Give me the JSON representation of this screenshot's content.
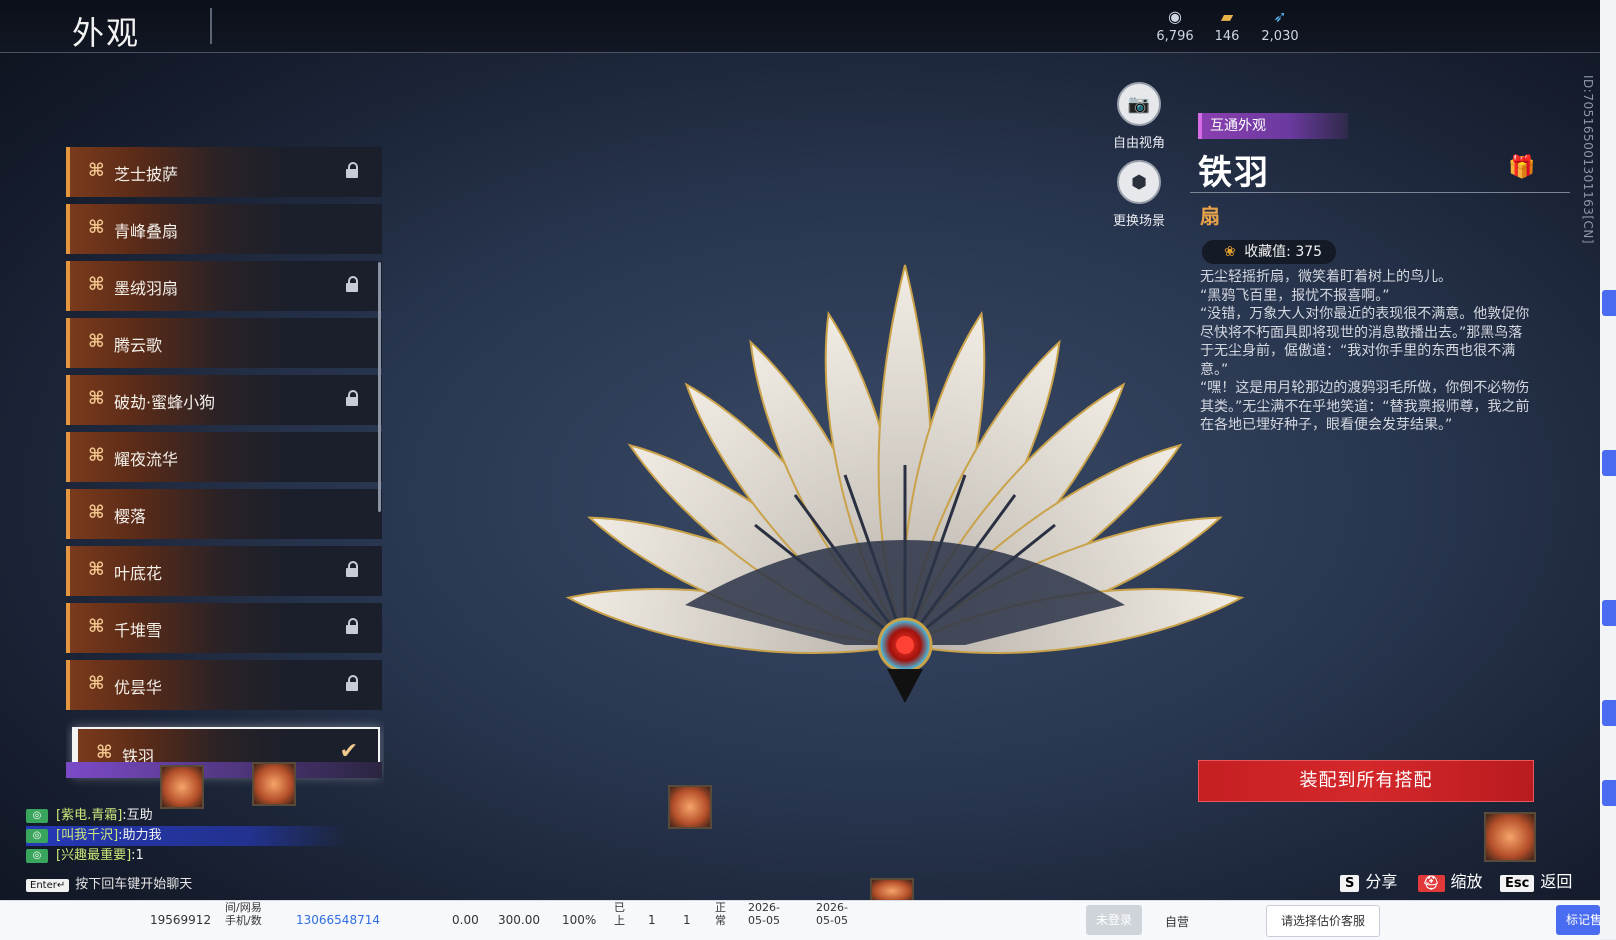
{
  "header": {
    "title": "外观",
    "currencies": [
      {
        "icon": "coin-icon",
        "value": "6,796"
      },
      {
        "icon": "ticket-icon",
        "value": "146"
      },
      {
        "icon": "feather-icon",
        "value": "2,030"
      }
    ]
  },
  "id_text": "ID:705165001301163[CN]",
  "list": {
    "items": [
      {
        "name": "芝士披萨",
        "locked": true
      },
      {
        "name": "青峰叠扇",
        "locked": false
      },
      {
        "name": "墨绒羽扇",
        "locked": true
      },
      {
        "name": "腾云歌",
        "locked": false
      },
      {
        "name": "破劫·蜜蜂小狗",
        "locked": true
      },
      {
        "name": "耀夜流华",
        "locked": false
      },
      {
        "name": "樱落",
        "locked": false
      },
      {
        "name": "叶底花",
        "locked": true
      },
      {
        "name": "千堆雪",
        "locked": true
      },
      {
        "name": "优昙华",
        "locked": true
      },
      {
        "name": "铁羽",
        "locked": false,
        "selected": true
      }
    ]
  },
  "camera": {
    "free_view": "自由视角",
    "change_scene": "更换场景"
  },
  "info": {
    "tag": "互通外观",
    "name": "铁羽",
    "category": "扇",
    "collect_label": "收藏值: 375",
    "description": [
      "无尘轻摇折扇，微笑着盯着树上的鸟儿。",
      "“黑鸦飞百里，报忧不报喜啊。”",
      "“没错，万象大人对你最近的表现很不满意。他敦促你尽快将不朽面具即将现世的消息散播出去。”那黑鸟落于无尘身前，倨傲道：“我对你手里的东西也很不满意。”",
      "“嘿！这是用月轮那边的渡鸦羽毛所做，你倒不必物伤其类。”无尘满不在乎地笑道：“替我禀报师尊，我之前在各地已埋好种子，眼看便会发芽结果。”"
    ],
    "equip_button": "装配到所有搭配"
  },
  "chat": {
    "lines": [
      {
        "tag": "[紫电.青霜]",
        "text": ":互助",
        "highlight": false
      },
      {
        "tag": "[叫我千沢]",
        "text": ":助力我",
        "highlight": true
      },
      {
        "tag": "[兴趣最重要]",
        "text": ":1",
        "highlight": false
      }
    ],
    "hint_key": "Enter↵",
    "hint": "按下回车键开始聊天"
  },
  "shortcuts": [
    {
      "key": "S",
      "label": "分享"
    },
    {
      "key": "⛑",
      "label": "缩放"
    },
    {
      "key": "Esc",
      "label": "返回"
    }
  ],
  "table_row": {
    "id": "19569912",
    "channel_line1": "间/网易",
    "channel_line2": "手机/数",
    "phone": "13066548714",
    "v1": "0.00",
    "v2": "300.00",
    "pct": "100%",
    "c1_line1": "已",
    "c1_line2": "上",
    "n1": "1",
    "n2": "1",
    "c2_line1": "正",
    "c2_line2": "常",
    "date1_line1": "2026-",
    "date1_line2": "05-05",
    "date2_line1": "2026-",
    "date2_line2": "05-05",
    "status_btn": "未登录",
    "type": "自营",
    "select_placeholder": "请选择估价客服",
    "mark_btn": "标记售后"
  }
}
